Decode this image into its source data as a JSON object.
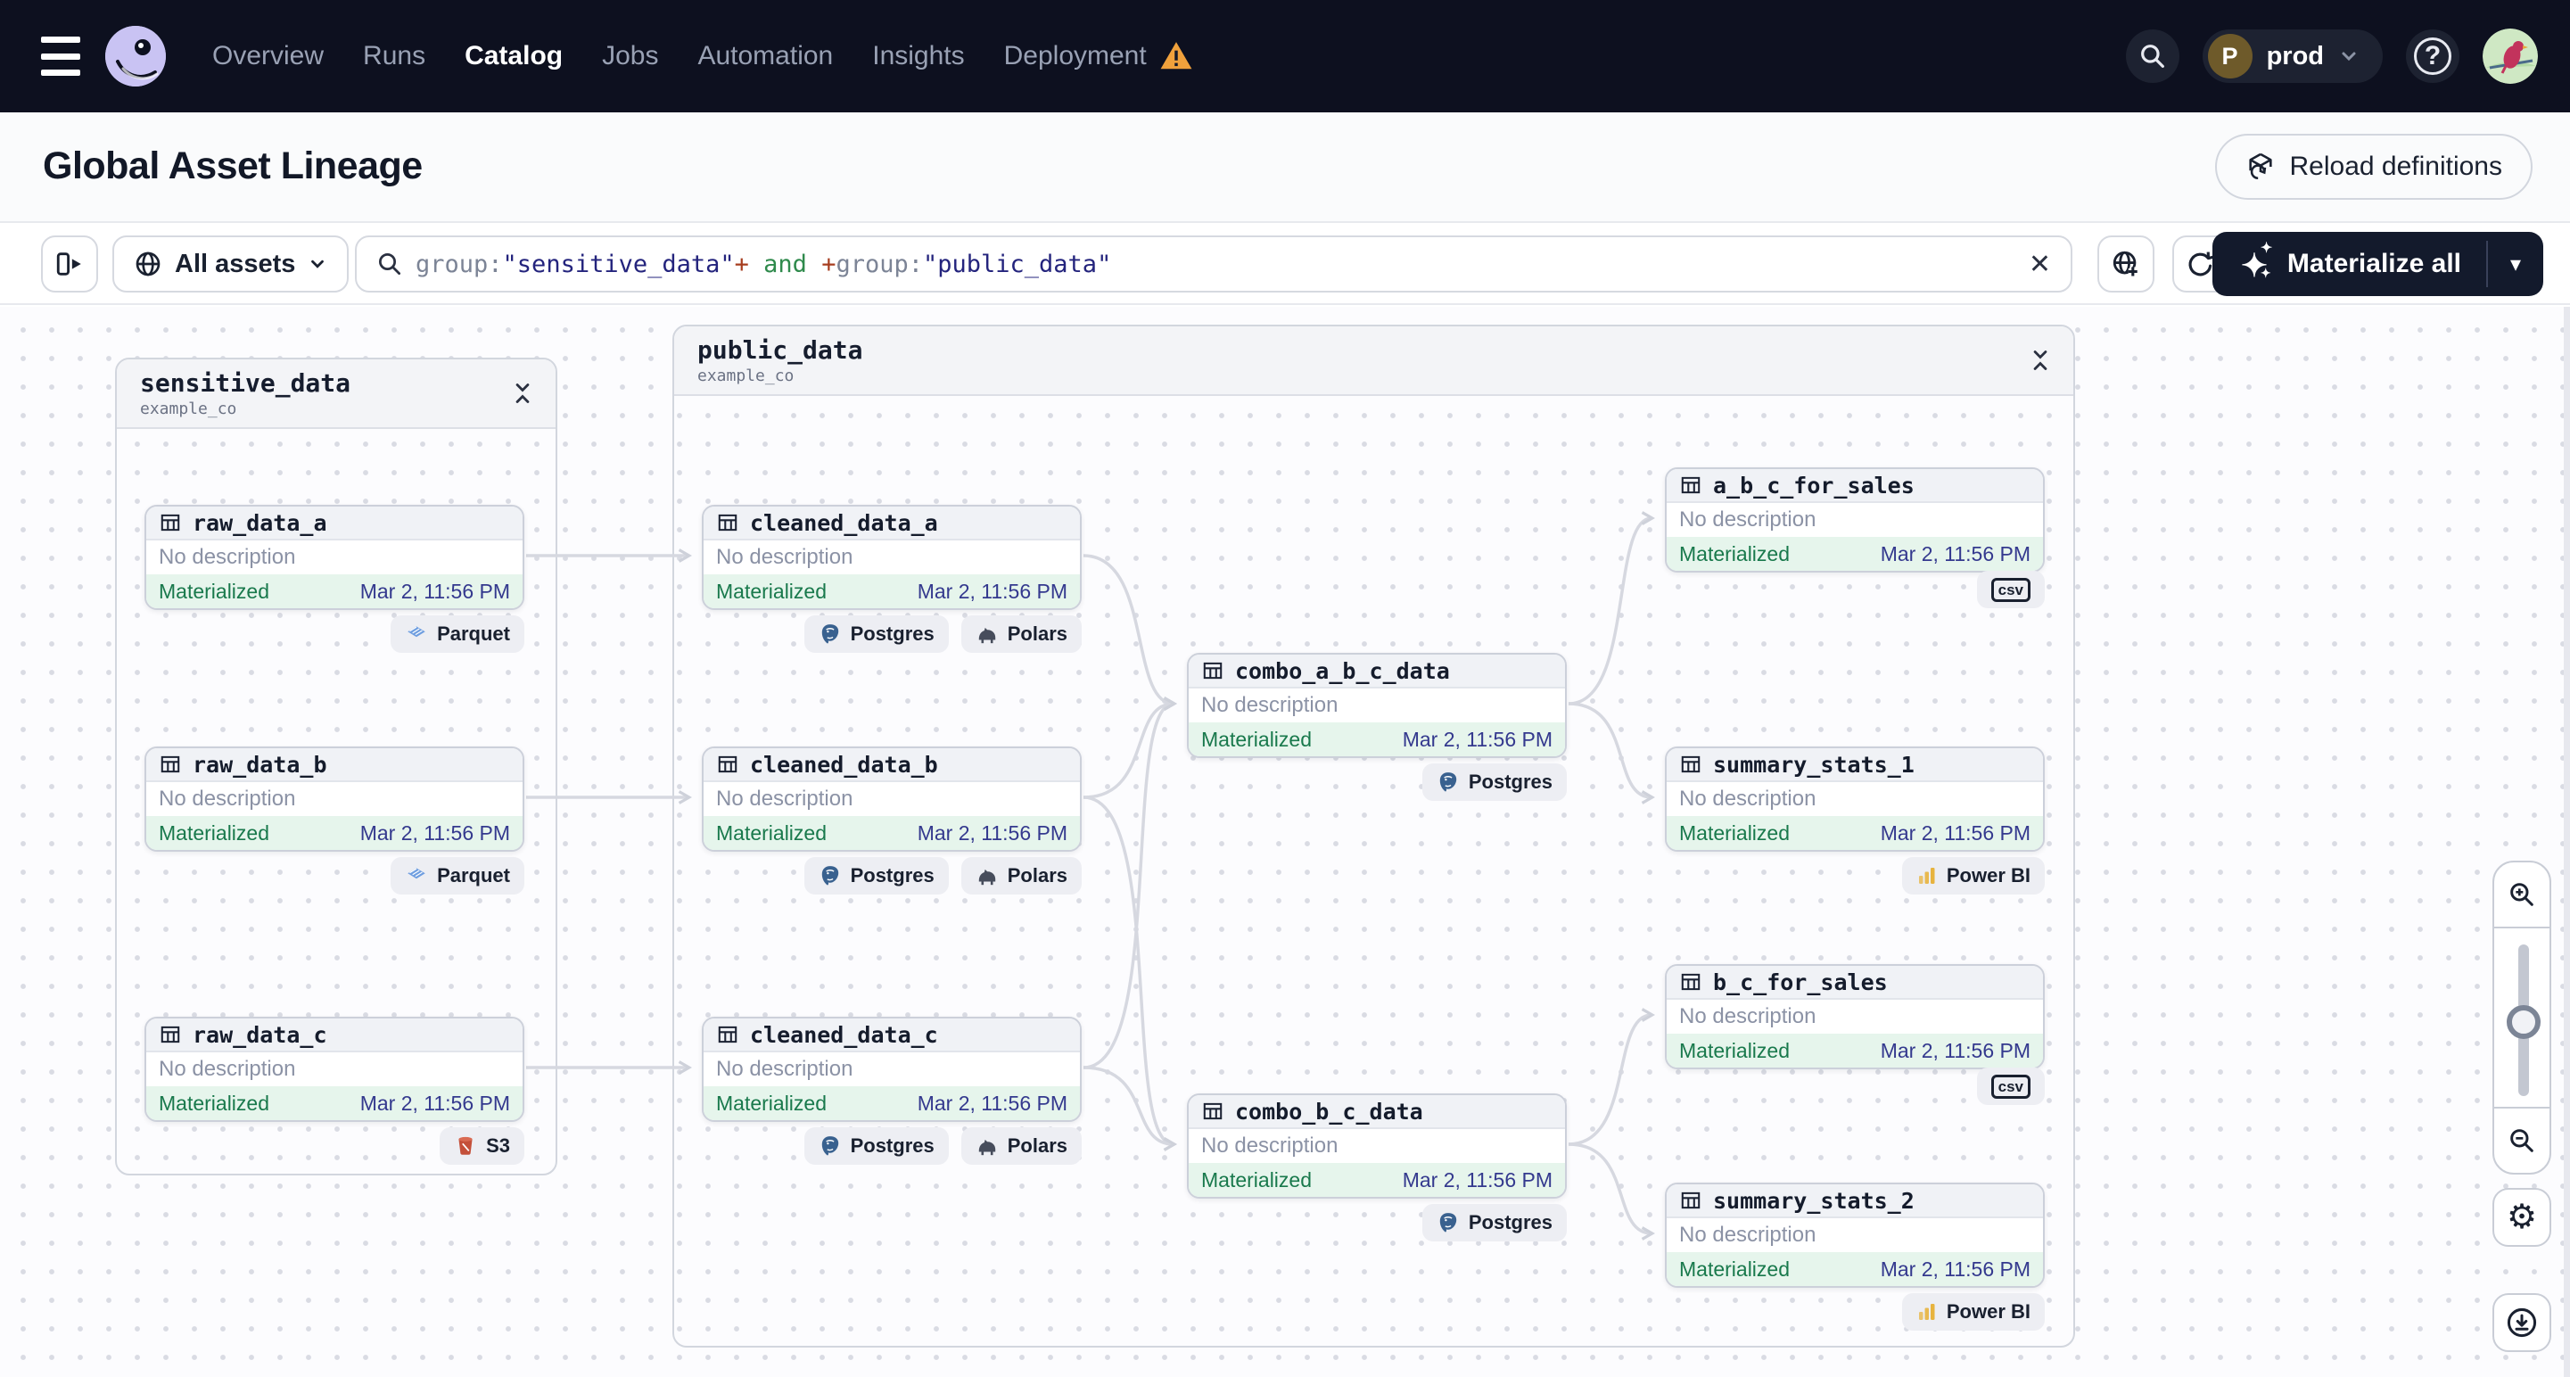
{
  "nav": {
    "items": [
      {
        "label": "Overview"
      },
      {
        "label": "Runs"
      },
      {
        "label": "Catalog"
      },
      {
        "label": "Jobs"
      },
      {
        "label": "Automation"
      },
      {
        "label": "Insights"
      },
      {
        "label": "Deployment"
      }
    ],
    "workspace": {
      "initial": "P",
      "name": "prod"
    }
  },
  "header": {
    "title": "Global Asset Lineage",
    "reload_button": "Reload definitions"
  },
  "toolbar": {
    "scope_label": "All assets",
    "materialize_label": "Materialize all",
    "query": [
      {
        "text": "group:",
        "type": "key"
      },
      {
        "text": "\"sensitive_data\"",
        "type": "string"
      },
      {
        "text": "+",
        "type": "plus"
      },
      {
        "text": " and ",
        "type": "and"
      },
      {
        "text": "+",
        "type": "plus"
      },
      {
        "text": "group:",
        "type": "key"
      },
      {
        "text": "\"public_data\"",
        "type": "string"
      }
    ]
  },
  "groups": [
    {
      "name": "sensitive_data",
      "location": "example_co"
    },
    {
      "name": "public_data",
      "location": "example_co"
    }
  ],
  "assets": [
    {
      "name": "raw_data_a",
      "description": "No description",
      "status": "Materialized",
      "timestamp": "Mar 2, 11:56 PM",
      "badges": [
        {
          "label": "Parquet"
        }
      ]
    },
    {
      "name": "raw_data_b",
      "description": "No description",
      "status": "Materialized",
      "timestamp": "Mar 2, 11:56 PM",
      "badges": [
        {
          "label": "Parquet"
        }
      ]
    },
    {
      "name": "raw_data_c",
      "description": "No description",
      "status": "Materialized",
      "timestamp": "Mar 2, 11:56 PM",
      "badges": [
        {
          "label": "S3"
        }
      ]
    },
    {
      "name": "cleaned_data_a",
      "description": "No description",
      "status": "Materialized",
      "timestamp": "Mar 2, 11:56 PM",
      "badges": [
        {
          "label": "Postgres"
        },
        {
          "label": "Polars"
        }
      ]
    },
    {
      "name": "cleaned_data_b",
      "description": "No description",
      "status": "Materialized",
      "timestamp": "Mar 2, 11:56 PM",
      "badges": [
        {
          "label": "Postgres"
        },
        {
          "label": "Polars"
        }
      ]
    },
    {
      "name": "cleaned_data_c",
      "description": "No description",
      "status": "Materialized",
      "timestamp": "Mar 2, 11:56 PM",
      "badges": [
        {
          "label": "Postgres"
        },
        {
          "label": "Polars"
        }
      ]
    },
    {
      "name": "combo_a_b_c_data",
      "description": "No description",
      "status": "Materialized",
      "timestamp": "Mar 2, 11:56 PM",
      "badges": [
        {
          "label": "Postgres"
        }
      ]
    },
    {
      "name": "combo_b_c_data",
      "description": "No description",
      "status": "Materialized",
      "timestamp": "Mar 2, 11:56 PM",
      "badges": [
        {
          "label": "Postgres"
        }
      ]
    },
    {
      "name": "a_b_c_for_sales",
      "description": "No description",
      "status": "Materialized",
      "timestamp": "Mar 2, 11:56 PM",
      "badges": [
        {
          "label": "csv"
        }
      ]
    },
    {
      "name": "summary_stats_1",
      "description": "No description",
      "status": "Materialized",
      "timestamp": "Mar 2, 11:56 PM",
      "badges": [
        {
          "label": "Power BI"
        }
      ]
    },
    {
      "name": "b_c_for_sales",
      "description": "No description",
      "status": "Materialized",
      "timestamp": "Mar 2, 11:56 PM",
      "badges": [
        {
          "label": "csv"
        }
      ]
    },
    {
      "name": "summary_stats_2",
      "description": "No description",
      "status": "Materialized",
      "timestamp": "Mar 2, 11:56 PM",
      "badges": [
        {
          "label": "Power BI"
        }
      ]
    }
  ],
  "icons": {
    "gear": "⚙",
    "sparkle": "✦",
    "close": "✕",
    "caret": "▾",
    "question": "?"
  },
  "colors": {
    "topbar": "#0d101f",
    "accent_dark": "#131a2c",
    "materialized_green": "#19794c",
    "timestamp_indigo": "#34398e",
    "warning": "#f0a13c"
  }
}
